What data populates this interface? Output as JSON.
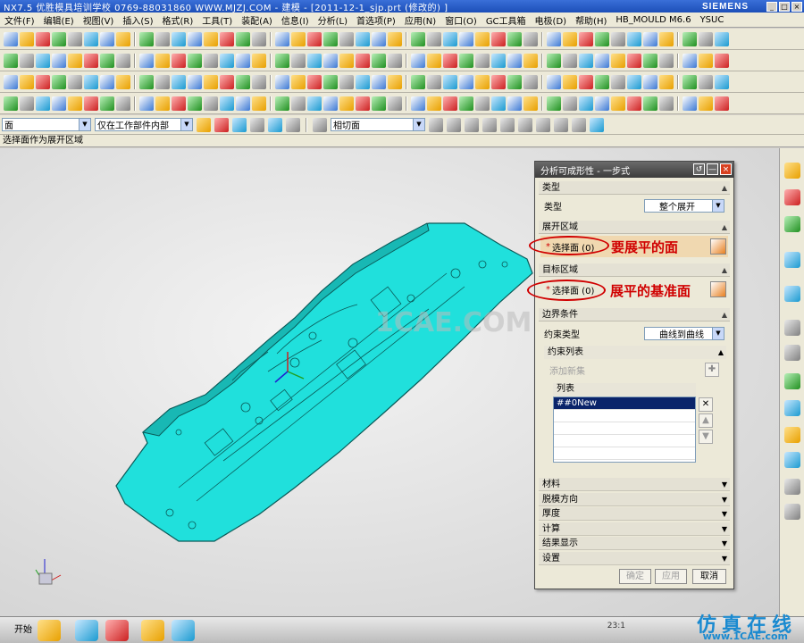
{
  "window": {
    "title": "NX7.5  优胜模具培训学校  0769-88031860  WWW.MJZJ.COM - 建模 - [2011-12-1_sjp.prt  (修改的) ]",
    "brand": "SIEMENS"
  },
  "menu": [
    "文件(F)",
    "编辑(E)",
    "视图(V)",
    "插入(S)",
    "格式(R)",
    "工具(T)",
    "装配(A)",
    "信息(I)",
    "分析(L)",
    "首选项(P)",
    "应用(N)",
    "窗口(O)",
    "GC工具箱",
    "电极(D)",
    "帮助(H)",
    "HB_MOULD M6.6",
    "YSUC"
  ],
  "selection_bar": {
    "filter": "面",
    "scope": "仅在工作部件内部",
    "face_rule": "相切面"
  },
  "cue_line": "选择面作为展开区域",
  "dialog": {
    "title": "分析可成形性 - 一步式",
    "type_section": "类型",
    "type_label": "类型",
    "type_value": "整个展开",
    "unfold_section": "展开区域",
    "unfold_select": "选择面 (0)",
    "target_section": "目标区域",
    "target_select": "选择面 (0)",
    "boundary_section": "边界条件",
    "constraint_type_label": "约束类型",
    "constraint_type_value": "曲线到曲线",
    "constraint_list_header": "约束列表",
    "add_new_set": "添加新集",
    "list_header": "列表",
    "list_items": [
      "##0New"
    ],
    "collapsed_sections": [
      "材料",
      "脱模方向",
      "厚度",
      "计算",
      "结果显示",
      "设置"
    ],
    "btn_ok": "确定",
    "btn_apply": "应用",
    "btn_cancel": "取消"
  },
  "annotations": {
    "unfold_note": "要展平的面",
    "target_note": "展平的基准面"
  },
  "viewport": {
    "watermark": "1CAE.COM"
  },
  "taskbar": {
    "start": "开始",
    "tray_time": "23:1"
  },
  "watermark": {
    "line1": "仿真在线",
    "line2": "www.1CAE.com"
  },
  "colors": {
    "part": "#20e0dc",
    "part_edge": "#0a5a58",
    "annotation": "#d00000"
  }
}
